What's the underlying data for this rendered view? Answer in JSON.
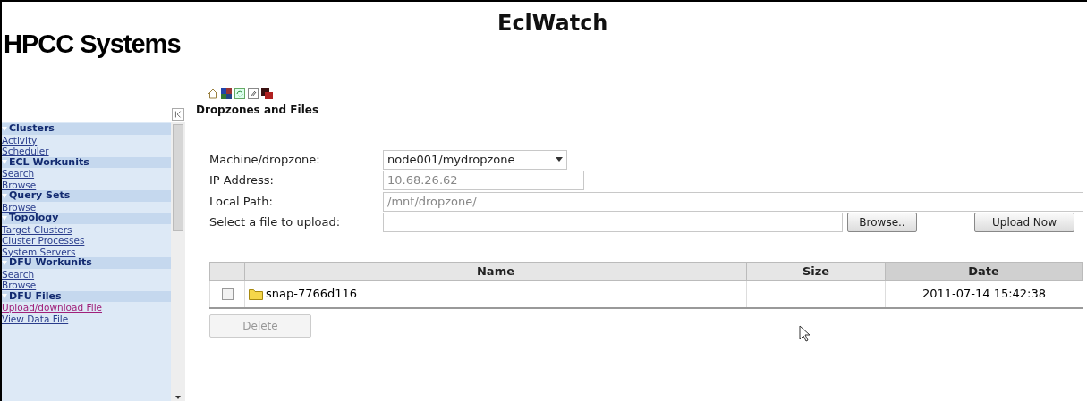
{
  "header": {
    "logo": "HPCC Systems",
    "title": "EclWatch"
  },
  "sidebar": {
    "sections": [
      {
        "title": "Clusters",
        "expanded": true,
        "items": [
          {
            "label": "Activity",
            "visited": false
          },
          {
            "label": "Scheduler",
            "visited": false
          }
        ]
      },
      {
        "title": "ECL Workunits",
        "expanded": true,
        "items": [
          {
            "label": "Search",
            "visited": false
          },
          {
            "label": "Browse",
            "visited": false
          }
        ]
      },
      {
        "title": "Query Sets",
        "expanded": true,
        "items": [
          {
            "label": "Browse",
            "visited": false
          }
        ]
      },
      {
        "title": "Topology",
        "expanded": true,
        "items": [
          {
            "label": "Target Clusters",
            "visited": false
          },
          {
            "label": "Cluster Processes",
            "visited": false
          },
          {
            "label": "System Servers",
            "visited": false
          }
        ]
      },
      {
        "title": "DFU Workunits",
        "expanded": true,
        "items": [
          {
            "label": "Search",
            "visited": false
          },
          {
            "label": "Browse",
            "visited": false
          }
        ]
      },
      {
        "title": "DFU Files",
        "expanded": true,
        "items": [
          {
            "label": "Upload/download File",
            "visited": true
          },
          {
            "label": "View Data File",
            "visited": false
          }
        ]
      }
    ]
  },
  "page": {
    "heading": "Dropzones and Files",
    "form": [
      {
        "kind": "select",
        "label": "Machine/dropzone:",
        "value": "node001/mydropzone"
      },
      {
        "kind": "readonly",
        "label": "IP Address:",
        "value": "10.68.26.62"
      },
      {
        "kind": "readonly",
        "label": "Local Path:",
        "value": "/mnt/dropzone/"
      },
      {
        "kind": "file",
        "label": "Select a file to upload:",
        "browse": "Browse..",
        "upload": "Upload Now"
      }
    ],
    "table": {
      "columns": [
        {
          "label": "Name",
          "sorted": false
        },
        {
          "label": "Size",
          "sorted": false
        },
        {
          "label": "Date",
          "sorted": true
        }
      ],
      "rows": [
        {
          "checked": false,
          "name": "snap-7766d116",
          "size_cell": "",
          "date": "2011-07-14 15:42:38"
        }
      ]
    },
    "delete_button": {
      "label": "Delete",
      "disabled": true
    }
  }
}
